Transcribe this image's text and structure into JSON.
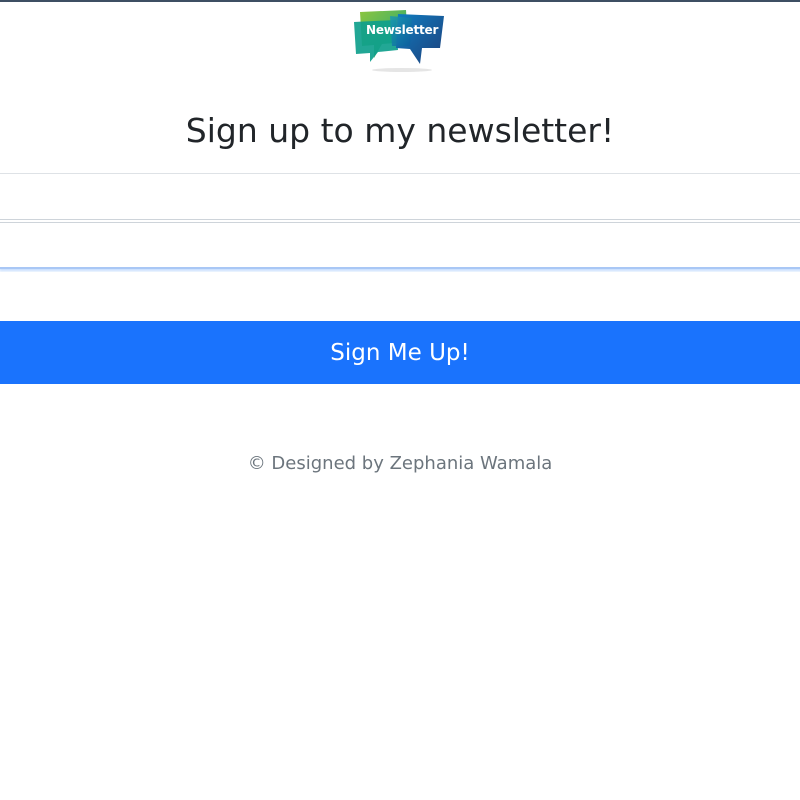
{
  "logo": {
    "text": "Newsletter",
    "colors": {
      "green": "#6cc04a",
      "teal": "#0e9b8e",
      "blue": "#0a6db3",
      "navy": "#1c4f8c"
    }
  },
  "heading": "Sign up to my newsletter!",
  "form": {
    "first_name": {
      "value": "",
      "placeholder": ""
    },
    "last_name": {
      "value": "",
      "placeholder": ""
    },
    "email": {
      "value": "",
      "placeholder": ""
    },
    "submit_label": "Sign Me Up!"
  },
  "footer": "© Designed by Zephania Wamala",
  "colors": {
    "primary": "#1a73fd",
    "heading_text": "#212529",
    "muted_text": "#6c757d",
    "input_border": "#ced4da",
    "focus_glow": "#a9c7f5"
  }
}
